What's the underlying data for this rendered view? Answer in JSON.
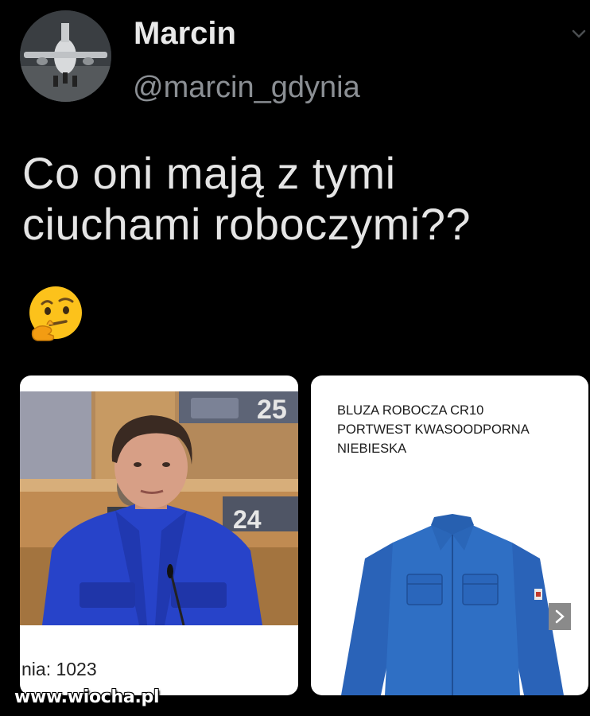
{
  "author": {
    "display_name": "Marcin",
    "handle": "@marcin_gdynia"
  },
  "icons": {
    "avatar": "airplane-photo",
    "menu": "chevron-down-icon",
    "emoji": "thinking-face-icon",
    "next": "chevron-right-icon"
  },
  "tweet": {
    "line1": "Co oni mają z tymi",
    "line2": "ciuchami roboczymi??"
  },
  "media": {
    "left": {
      "caption": "nia: 1023"
    },
    "right": {
      "title_line1": "BLUZA ROBOCZA CR10",
      "title_line2": "PORTWEST KWASOODPORNA",
      "title_line3": "NIEBIESKA"
    }
  },
  "watermark": "www.wiocha.pl",
  "colors": {
    "background": "#000000",
    "name": "#e9e9e9",
    "handle": "#8b8f94",
    "jacket_blue": "#2f6fc4",
    "blazer_blue": "#2743c9"
  }
}
